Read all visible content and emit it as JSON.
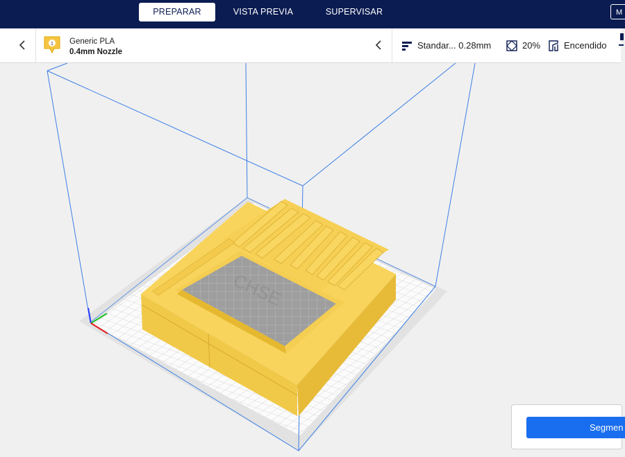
{
  "header": {
    "tabs": [
      {
        "label": "PREPARAR",
        "active": true
      },
      {
        "label": "VISTA PREVIA",
        "active": false
      },
      {
        "label": "SUPERVISAR",
        "active": false
      }
    ],
    "marketplace_label": "M"
  },
  "printer": {
    "extruder_number": "1",
    "material": "Generic PLA",
    "nozzle": "0.4mm Nozzle"
  },
  "print_settings": {
    "profile": "Standar... 0.28mm",
    "infill": "20%",
    "support": "Encendido"
  },
  "slice": {
    "button_label": "Segmen"
  },
  "colors": {
    "header_bg": "#0b1c52",
    "accent": "#196ef0",
    "model": "#f5d15a",
    "build_volume": "#3b7ee6"
  }
}
